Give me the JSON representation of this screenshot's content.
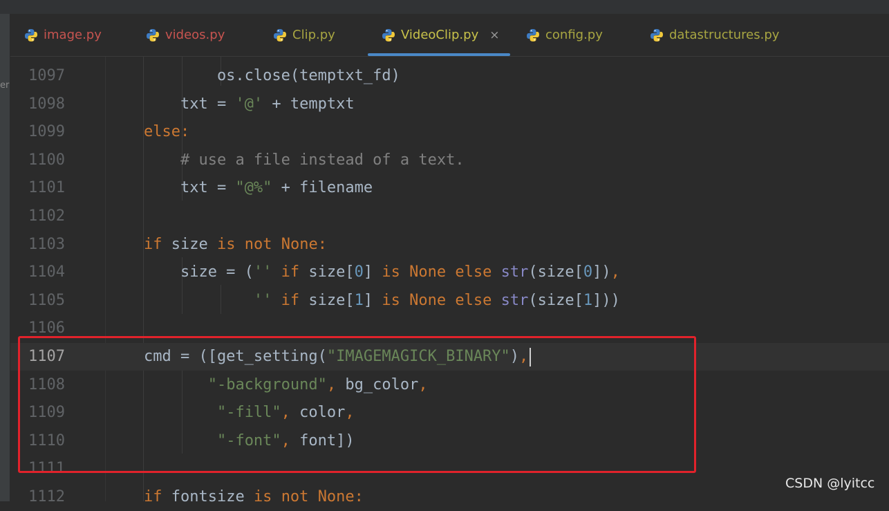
{
  "left_strip_label": "er",
  "tabs": [
    {
      "label": "image.py",
      "color": "#c75450",
      "active": false
    },
    {
      "label": "videos.py",
      "color": "#c75450",
      "active": false
    },
    {
      "label": "Clip.py",
      "color": "#a8a642",
      "active": false
    },
    {
      "label": "VideoClip.py",
      "color": "#c8c24a",
      "active": true,
      "close": "×"
    },
    {
      "label": "config.py",
      "color": "#a8a642",
      "active": false
    },
    {
      "label": "datastructures.py",
      "color": "#a8a642",
      "active": false
    }
  ],
  "editor": {
    "current_line": "1107",
    "lines": [
      {
        "no": "1097",
        "code": "            os.close(temptxt_fd)"
      },
      {
        "no": "1098",
        "code": "        txt = '@' + temptxt"
      },
      {
        "no": "1099",
        "code": "    else:"
      },
      {
        "no": "1100",
        "code": "        # use a file instead of a text."
      },
      {
        "no": "1101",
        "code": "        txt = \"@%\" + filename"
      },
      {
        "no": "1102",
        "code": ""
      },
      {
        "no": "1103",
        "code": "    if size is not None:"
      },
      {
        "no": "1104",
        "code": "        size = ('' if size[0] is None else str(size[0]),"
      },
      {
        "no": "1105",
        "code": "                '' if size[1] is None else str(size[1]))"
      },
      {
        "no": "1106",
        "code": ""
      },
      {
        "no": "1107",
        "code": "    cmd = ([get_setting(\"IMAGEMAGICK_BINARY\"),"
      },
      {
        "no": "1108",
        "code": "           \"-background\", bg_color,"
      },
      {
        "no": "1109",
        "code": "            \"-fill\", color,"
      },
      {
        "no": "1110",
        "code": "            \"-font\", font])"
      },
      {
        "no": "1111",
        "code": ""
      },
      {
        "no": "1112",
        "code": "    if fontsize is not None:"
      }
    ]
  },
  "icons": {
    "tab_file": "python-file-icon",
    "gutter": "lightbulb-intention-icon"
  },
  "watermark": "CSDN @lyitcc",
  "colors": {
    "highlight_box": "#e1222b",
    "active_tab_underline": "#4a88c7",
    "background": "#2b2b2b"
  }
}
